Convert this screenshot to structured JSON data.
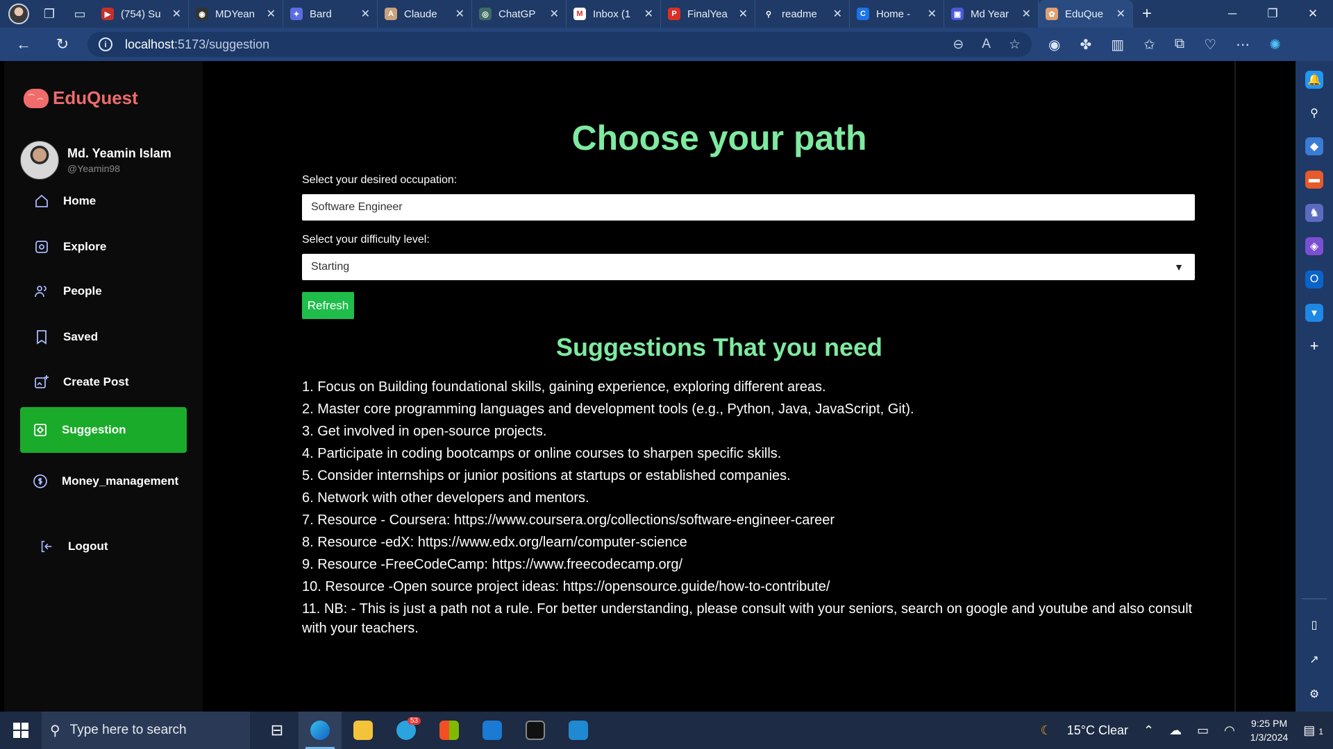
{
  "browser": {
    "tabs": [
      {
        "label": "(754) Su",
        "fav_color": "#c4302b",
        "fav_text": "▶"
      },
      {
        "label": "MDYean",
        "fav_color": "#333333",
        "fav_text": "◉"
      },
      {
        "label": "Bard",
        "fav_color": "#5b6ee1",
        "fav_text": "✦"
      },
      {
        "label": "Claude",
        "fav_color": "#c9a27e",
        "fav_text": "A"
      },
      {
        "label": "ChatGP",
        "fav_color": "#3e6b63",
        "fav_text": "◎"
      },
      {
        "label": "Inbox (1",
        "fav_color": "#ffffff",
        "fav_text": "M"
      },
      {
        "label": "FinalYea",
        "fav_color": "#d93025",
        "fav_text": "P"
      },
      {
        "label": "readme",
        "fav_color": "#1f3a66",
        "fav_text": "⚲"
      },
      {
        "label": "Home -",
        "fav_color": "#1a73e8",
        "fav_text": "C"
      },
      {
        "label": "Md Year",
        "fav_color": "#4a5bd4",
        "fav_text": "▣"
      },
      {
        "label": "EduQue",
        "fav_color": "#e0a070",
        "fav_text": "✿",
        "active": true
      }
    ],
    "url_host": "localhost",
    "url_path": ":5173/suggestion"
  },
  "app": {
    "brand": "EduQuest",
    "user": {
      "name": "Md. Yeamin Islam",
      "handle": "@Yeamin98"
    },
    "nav": [
      {
        "label": "Home",
        "icon": "home-icon"
      },
      {
        "label": "Explore",
        "icon": "explore-icon"
      },
      {
        "label": "People",
        "icon": "people-icon"
      },
      {
        "label": "Saved",
        "icon": "bookmark-icon"
      },
      {
        "label": "Create Post",
        "icon": "create-post-icon"
      },
      {
        "label": "Suggestion",
        "icon": "suggestion-icon",
        "active": true
      },
      {
        "label": "Money_management",
        "icon": "money-icon"
      }
    ],
    "logout": "Logout"
  },
  "main": {
    "title": "Choose your path",
    "occupation_label": "Select your desired occupation:",
    "occupation_value": "Software Engineer",
    "difficulty_label": "Select your difficulty level:",
    "difficulty_value": "Starting",
    "refresh": "Refresh",
    "suggestions_title": "Suggestions That you need",
    "suggestions": [
      "1. Focus on Building foundational skills, gaining experience, exploring different areas.",
      "2. Master core programming languages and development tools (e.g., Python, Java, JavaScript, Git).",
      "3. Get involved in open-source projects.",
      "4. Participate in coding bootcamps or online courses to sharpen specific skills.",
      "5. Consider internships or junior positions at startups or established companies.",
      "6. Network with other developers and mentors.",
      "7. Resource - Coursera: https://www.coursera.org/collections/software-engineer-career",
      "8. Resource -edX: https://www.edx.org/learn/computer-science",
      "9. Resource -FreeCodeCamp: https://www.freecodecamp.org/",
      "10. Resource -Open source project ideas: https://opensource.guide/how-to-contribute/",
      "11. NB: - This is just a path not a rule. For better understanding, please consult with your seniors, search on google and youtube and also consult with your teachers."
    ]
  },
  "taskbar": {
    "search_placeholder": "Type here to search",
    "weather": "15°C  Clear",
    "time": "9:25 PM",
    "date": "1/3/2024",
    "telegram_badge": "53",
    "notif_count": "1"
  }
}
